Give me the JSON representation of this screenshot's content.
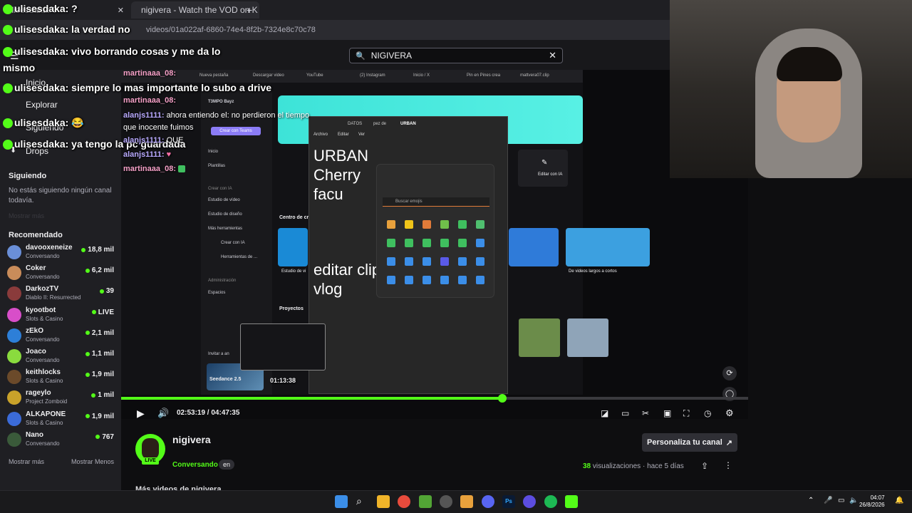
{
  "browser": {
    "tabs": [
      {
        "label": "ulisesdaka: ?",
        "active": false
      },
      {
        "label": "nigivera - Watch the VOD on K",
        "active": true
      }
    ],
    "new_tab": "+",
    "url": "videos/01a022af-6860-74e4-8f2b-7324e8c70c78"
  },
  "nav": {
    "search_value": "NIGIVERA",
    "menu_items": [
      "Inicio",
      "Explorar",
      "Siguiendo",
      "Drops"
    ]
  },
  "sidebar": {
    "following_title": "Siguiendo",
    "following_empty": "No estás siguiendo ningún canal todavía.",
    "show_more_faded": "Mostrar más",
    "recommended_title": "Recomendado",
    "channels": [
      {
        "name": "davooxeneize",
        "game": "Conversando",
        "viewers": "18,8 mil"
      },
      {
        "name": "Coker",
        "game": "Conversando",
        "viewers": "6,2 mil"
      },
      {
        "name": "DarkozTV",
        "game": "Diablo II: Resurrected",
        "viewers": "39"
      },
      {
        "name": "kyootbot",
        "game": "Slots & Casino",
        "viewers": "LIVE"
      },
      {
        "name": "zEkO",
        "game": "Conversando",
        "viewers": "2,1 mil"
      },
      {
        "name": "Joaco",
        "game": "Conversando",
        "viewers": "1,1 mil"
      },
      {
        "name": "keithlocks",
        "game": "Slots & Casino",
        "viewers": "1,9 mil"
      },
      {
        "name": "rageylo",
        "game": "Project Zomboid",
        "viewers": "1 mil"
      },
      {
        "name": "ALKAPONE",
        "game": "Slots & Casino",
        "viewers": "1,9 mil"
      },
      {
        "name": "Nano",
        "game": "Conversando",
        "viewers": "767"
      }
    ],
    "show_more": "Mostrar más",
    "show_less": "Mostrar Menos"
  },
  "chat_overlay": [
    {
      "user": "ulisesdaka:",
      "text": "?"
    },
    {
      "user": "ulisesdaka:",
      "text": "la verdad no"
    },
    {
      "user": "ulisesdaka:",
      "text": "vivo borrando cosas y me da lo mismo"
    },
    {
      "user": "ulisesdaka:",
      "text": "siempre lo mas importante lo subo a drive"
    },
    {
      "user": "ulisesdaka:",
      "text": "😂"
    },
    {
      "user": "ulisesdaka:",
      "text": "ya tengo la pc guardada"
    }
  ],
  "stream_chat": [
    {
      "user": "martinaaa_08:",
      "text": ""
    },
    {
      "user": "martinaaa_08:",
      "text": ""
    },
    {
      "user": "alanjs1111:",
      "text": "ahora entiendo el: no perdieron el tiempo"
    },
    {
      "user": "",
      "text": "que inocente fuimos"
    },
    {
      "user": "alanjs1111:",
      "text": "QUE"
    },
    {
      "user": "alanjs1111:",
      "text": ""
    },
    {
      "user": "martinaaa_08:",
      "text": ""
    }
  ],
  "stream_screen": {
    "inner_tabs": [
      "Nueva pestaña",
      "Descargar video",
      "YouTube",
      "(2) Instagram",
      "Inicio / X",
      "Pin en Pines crea",
      "mattvera07.clip",
      ""
    ],
    "canva_user": "T3MPO Bayz",
    "canva_button": "Crear con Teams",
    "canva_nav": [
      "Inicio",
      "Plantillas",
      "Crear con IA",
      "Estudio de vídeo",
      "Estudio de diseño",
      "Más herramientas",
      "Crear con IA",
      "Herramientas de ...",
      "Administración",
      "Espacios",
      "Invitar a an"
    ],
    "canva_section": "Centro de cre",
    "canva_projects": "Proyectos",
    "canva_promo": "Seedance 2.5",
    "canva_card_1": "Editar con IA",
    "canva_card_2": "De videos largos a cortos",
    "canva_card_3": "Estudio de vi",
    "notepad_tabs": [
      "DATOS",
      "pez de",
      "URBAN"
    ],
    "notepad_menu": [
      "Archivo",
      "Editar",
      "Ver"
    ],
    "notepad_text": "URBAN\nCherry\nfacu",
    "notepad_text2": "editar clip\nvlog",
    "emoji_search": "Buscar emojis"
  },
  "player": {
    "current_time": "02:53:19",
    "duration": "04:47:35",
    "hover_time": "01:13:38",
    "progress": 0.602
  },
  "channel": {
    "name": "nigivera",
    "live_badge": "LIVE",
    "category": "Conversando",
    "language": "en",
    "customize_label": "Personaliza tu canal",
    "views_count": "38",
    "views_label": "visualizaciones",
    "age": "hace 5 días",
    "more_videos": "Más videos de nigivera"
  },
  "taskbar": {
    "time": "04:07",
    "date": "26/8/2026"
  },
  "colors": {
    "accent": "#53fc18",
    "bg": "#0e0e10",
    "sidebar": "#1f1f23"
  }
}
